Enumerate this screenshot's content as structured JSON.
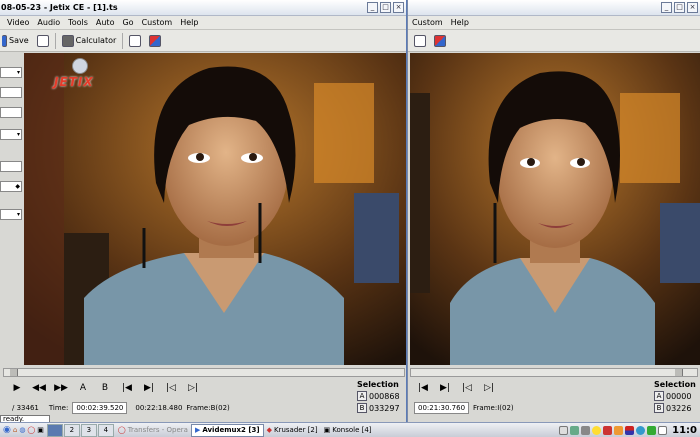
{
  "left": {
    "title": "08-05-23 - Jetix CE - [1].ts",
    "menu": [
      "Video",
      "Audio",
      "Tools",
      "Auto",
      "Go",
      "Custom",
      "Help"
    ],
    "toolbar": {
      "save": "Save",
      "calculator": "Calculator"
    },
    "logo_text": "JETIX",
    "selection": {
      "label": "Selection",
      "a_btn": "A",
      "b_btn": "B",
      "a_value": "000868",
      "b_value": "033297"
    },
    "status": {
      "total": "/ 33461",
      "time_label": "Time:",
      "time_value": "00:02:39.520",
      "duration": "00:22:18.480",
      "frame": "Frame:B(02)"
    },
    "nav_buttons": [
      "▶",
      "◀◀",
      "▶▶",
      "A",
      "B",
      "|◀",
      "▶|",
      "|◁",
      "▷|"
    ]
  },
  "right": {
    "menu": [
      "Custom",
      "Help"
    ],
    "selection": {
      "label": "Selection",
      "a_btn": "A",
      "b_btn": "B",
      "a_value": "00000",
      "b_value": "03226"
    },
    "status": {
      "time_value": "00:21:30.760",
      "frame": "Frame:I(02)"
    },
    "nav_buttons": [
      "|◀",
      "▶|",
      "|◁",
      "▷|"
    ]
  },
  "window_buttons": {
    "min": "_",
    "max": "□",
    "close": "×"
  },
  "ready_text": "ready.",
  "taskbar": {
    "desktops": [
      "2",
      "3",
      "4"
    ],
    "tasks": [
      {
        "label": "Transfers - Opera",
        "state": "dim"
      },
      {
        "label": "Avidemux2 [3]",
        "state": "active"
      },
      {
        "label": "Krusader [2]",
        "state": "normal"
      },
      {
        "label": "Konsole [4]",
        "state": "normal"
      }
    ],
    "clock": "11:0"
  }
}
